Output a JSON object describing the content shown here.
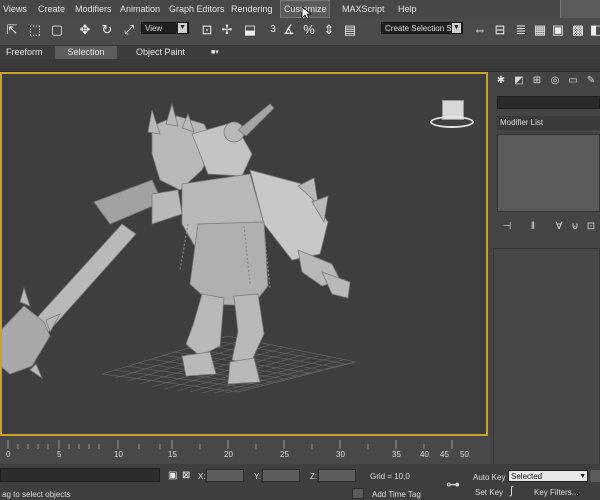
{
  "menu": {
    "items": [
      "Views",
      "Create",
      "Modifiers",
      "Animation",
      "Graph Editors",
      "Rendering",
      "Customize",
      "MAXScript",
      "Help"
    ],
    "active_index": 6
  },
  "toolbar": {
    "view_dropdown": "View",
    "number_label": "3",
    "selection_set_dropdown": "Create Selection Se"
  },
  "ribbon": {
    "tabs": [
      "Freeform",
      "Selection",
      "Object Paint"
    ],
    "active_index": 1
  },
  "command_panel": {
    "modifier_list_label": "Modifier List"
  },
  "timeline": {
    "ticks": [
      "0",
      "5",
      "10",
      "15",
      "20",
      "25",
      "30",
      "35",
      "40",
      "45",
      "50"
    ]
  },
  "status": {
    "prompt": "ag to select objects",
    "x_label": "X:",
    "y_label": "Y:",
    "z_label": "Z:",
    "grid": "Grid = 10,0",
    "add_time_tag": "Add Time Tag"
  },
  "keys": {
    "auto_key": "Auto Key",
    "selected_dropdown": "Selected",
    "set_key": "Set Key",
    "key_filters": "Key Filters..."
  },
  "colors": {
    "viewport_border": "#c9a22a",
    "viewport_bg": "#3e3e3e",
    "model": "#b9b9b9"
  }
}
